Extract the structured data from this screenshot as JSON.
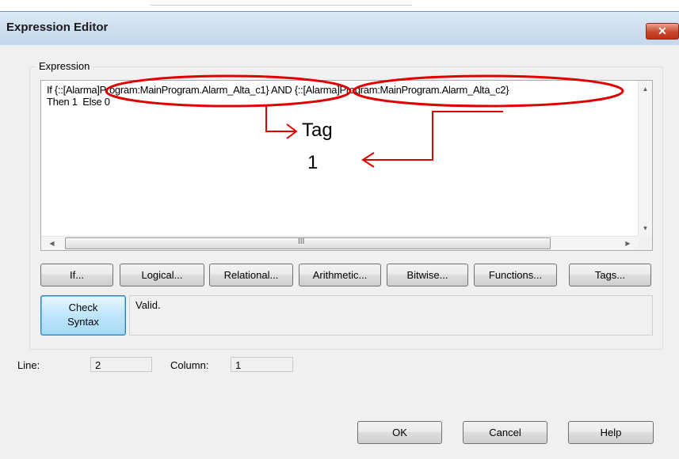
{
  "window": {
    "title": "Expression Editor",
    "close_label": "✕"
  },
  "expression": {
    "group_label": "Expression",
    "lines": [
      "If {::[Alarma]Program:MainProgram.Alarm_Alta_c1} AND {::[Alarma]Program:MainProgram.Alarm_Alta_c2}",
      "Then 1  Else 0"
    ],
    "hscroll_grip": "III"
  },
  "buttons": {
    "if": "If...",
    "logical": "Logical...",
    "relational": "Relational...",
    "arithmetic": "Arithmetic...",
    "bitwise": "Bitwise...",
    "functions": "Functions...",
    "tags": "Tags..."
  },
  "syntax": {
    "check_line1": "Check",
    "check_line2": "Syntax",
    "status": "Valid."
  },
  "position": {
    "line_label": "Line:",
    "line_value": "2",
    "column_label": "Column:",
    "column_value": "1"
  },
  "footer": {
    "ok": "OK",
    "cancel": "Cancel",
    "help": "Help"
  },
  "annotation": {
    "tag_line1": "Tag",
    "tag_line2": "1",
    "color": "#e00000"
  }
}
